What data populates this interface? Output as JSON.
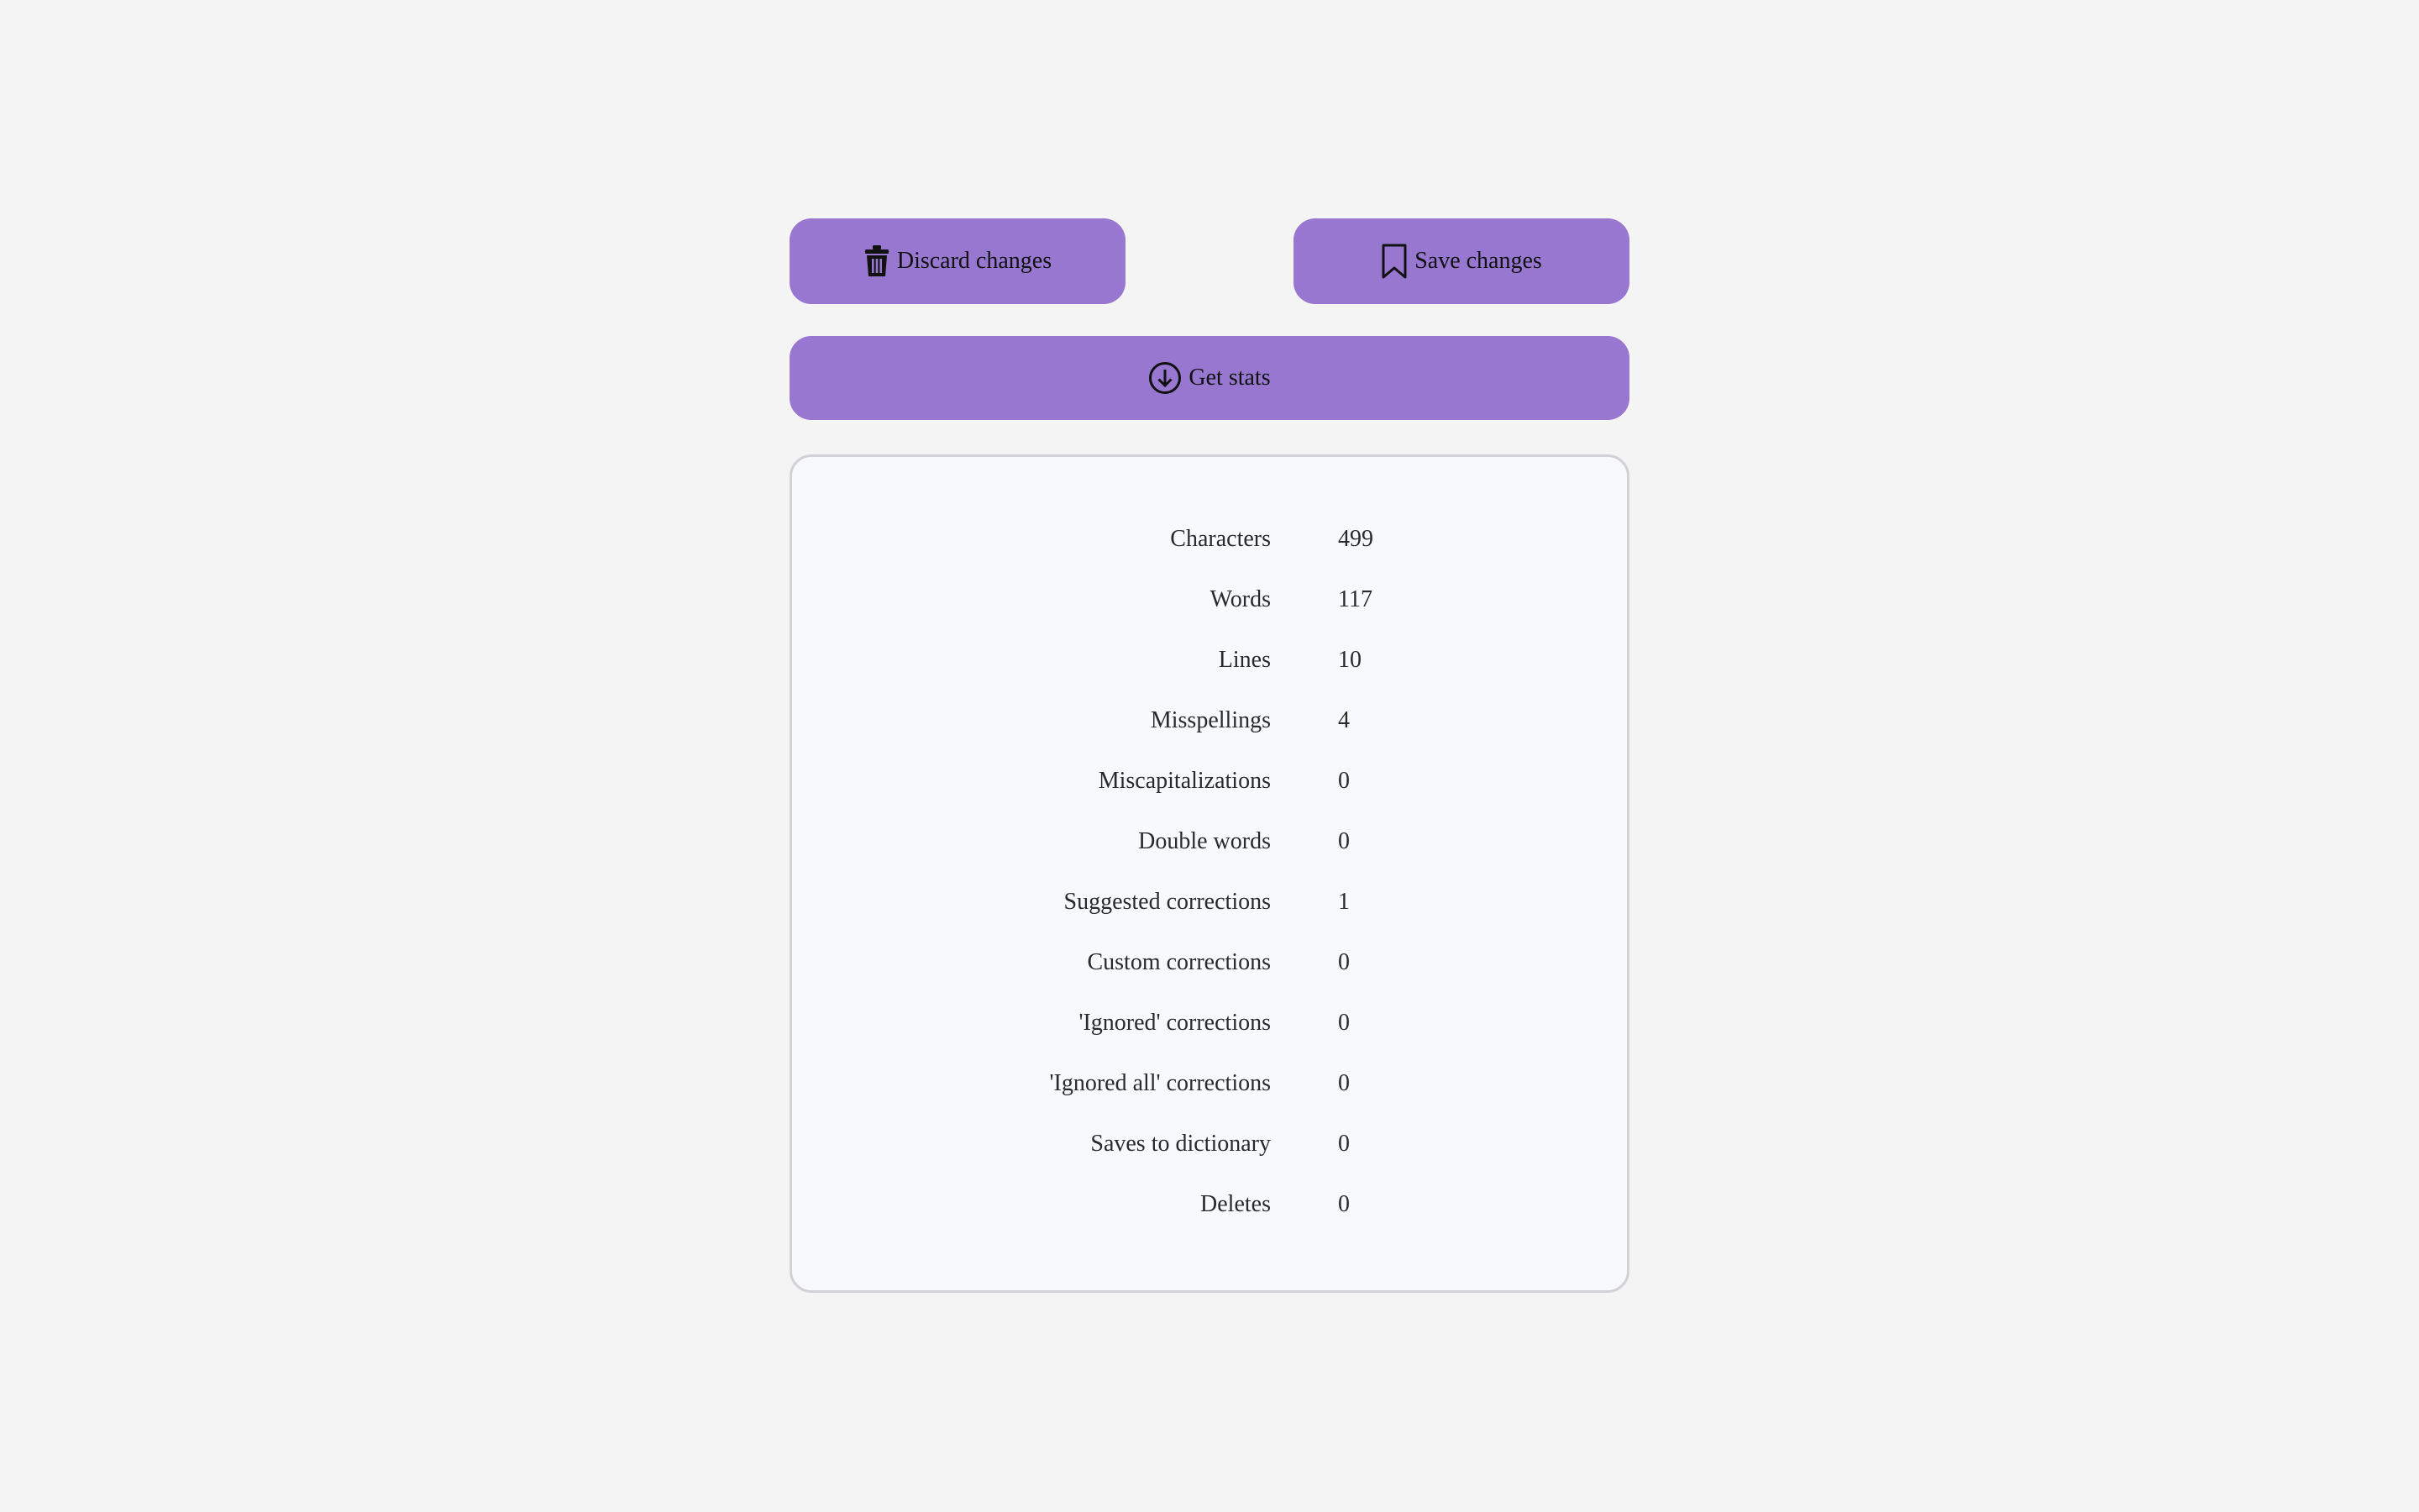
{
  "actions": {
    "discard_label": "Discard changes",
    "save_label": "Save changes",
    "stats_label": "Get stats"
  },
  "icons": {
    "discard": "trash-icon",
    "save": "bookmark-icon",
    "stats": "download-circle-icon"
  },
  "colors": {
    "accent": "#9777d0",
    "background": "#f4f4f4",
    "panel": "#f8f9fd",
    "panel_border": "#d2d2d6"
  },
  "stats": [
    {
      "label": "Characters",
      "value": "499"
    },
    {
      "label": "Words",
      "value": "117"
    },
    {
      "label": "Lines",
      "value": "10"
    },
    {
      "label": "Misspellings",
      "value": "4"
    },
    {
      "label": "Miscapitalizations",
      "value": "0"
    },
    {
      "label": "Double words",
      "value": "0"
    },
    {
      "label": "Suggested corrections",
      "value": "1"
    },
    {
      "label": "Custom corrections",
      "value": "0"
    },
    {
      "label": "'Ignored' corrections",
      "value": "0"
    },
    {
      "label": "'Ignored all' corrections",
      "value": "0"
    },
    {
      "label": "Saves to dictionary",
      "value": "0"
    },
    {
      "label": "Deletes",
      "value": "0"
    }
  ]
}
